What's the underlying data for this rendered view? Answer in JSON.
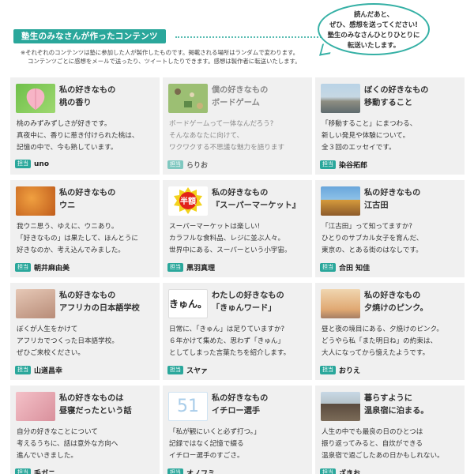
{
  "header": {
    "section_title": "塾生のみなさんが作ったコンテンツ",
    "notice_line1": "※それぞれのコンテンツは塾に参加した人が製作したものです。掲載される場所はランダムで変わります。",
    "notice_line2": "コンテンツごとに感想をメールで送ったり、ツイートしたりできます。感想は製作者に転送いたします。",
    "bubble_line1": "読んだあと、",
    "bubble_line2": "ぜひ、感想を送ってください!",
    "bubble_line3": "塾生のみなさんひとりひとりに",
    "bubble_line4": "転送いたします。"
  },
  "badge_label": "担当",
  "cards": [
    {
      "title1": "私の好きなもの",
      "title2": "桃の香り",
      "desc": [
        "桃のみずみずしさが好きです。",
        "真夜中に、香りに惹き付けられた桃は、",
        "記憶の中で、今も熟しています。"
      ],
      "author": "uno",
      "thumb": "peach-icon"
    },
    {
      "title1": "僕の好きなもの",
      "title2": "ボードゲーム",
      "desc": [
        "ボードゲームって一体なんだろう?",
        "そんなあなたに向けて、",
        "ワクワクする不思議な魅力を語ります"
      ],
      "author": "らりお",
      "thumb": "board-game-icon"
    },
    {
      "title1": "ぼくの好きなもの",
      "title2": "移動すること",
      "desc": [
        "「移動すること」にまつわる、",
        "新しい発見や体験について。",
        "全３回のエッセイです。"
      ],
      "author": "染谷拓郎",
      "thumb": "coast-photo"
    },
    {
      "title1": "私の好きなもの",
      "title2": "ウニ",
      "desc": [
        "我ウニ思う、ゆえに、ウニあり。",
        "「好きなもの」は果たして、ほんとうに",
        "好きなのか、考え込んでみました。"
      ],
      "author": "朝井麻由美",
      "thumb": "sea-urchin-photo"
    },
    {
      "title1": "私の好きなもの",
      "title2": "『スーパーマーケット』",
      "desc": [
        "スーパーマーケットは楽しい!",
        "カラフルな食料品、レジに並ぶ人々。",
        "世界中にある、スーパーという小宇宙。"
      ],
      "author": "黒羽真理",
      "thumb": "half-price-sticker",
      "sticker": "半額"
    },
    {
      "title1": "私の好きなもの",
      "title2": "江古田",
      "desc": [
        "「江古田」って知ってますか?",
        "ひとりのサブカル女子を育んだ、",
        "東京の、とある街のはなしです。"
      ],
      "author": "合田 知佳",
      "thumb": "town-photo"
    },
    {
      "title1": "私の好きなもの",
      "title2": "アフリカの日本語学校",
      "desc": [
        "ぼくが人生をかけて",
        "アフリカでつくった日本語学校。",
        "ぜひご来校ください。"
      ],
      "author": "山道昌幸",
      "thumb": "school-photo"
    },
    {
      "title1": "わたしの好きなもの",
      "title2": "「きゅんワード」",
      "desc": [
        "日常に、「きゅん」は足りていますか?",
        "６年かけて集めた、思わず「きゅん」",
        "としてしまった言葉たちを紹介します。"
      ],
      "author": "スヤァ",
      "thumb": "kyun-lettering",
      "thumb_text": "きゅん。"
    },
    {
      "title1": "私の好きなもの",
      "title2": "夕焼けのピンク。",
      "desc": [
        "昼と夜の境目にある、夕焼けのピンク。",
        "どうやら私「また明日ね」の約束は、",
        "大人になってから憶えたようです。"
      ],
      "author": "おりえ",
      "thumb": "sunset-photo"
    },
    {
      "title1": "私の好きなものは",
      "title2": "昼寝だったという話",
      "desc": [
        "自分の好きなことについて",
        "考えるうちに、話は意外な方向へ",
        "進んでいきました。"
      ],
      "author": "毛ガニ",
      "thumb": "nap-photo"
    },
    {
      "title1": "私の好きなもの",
      "title2": "イチロー選手",
      "desc": [
        "「私が観にいくと必ず打つ。」",
        "記録ではなく記憶で綴る",
        "イチロー選手のすごさ。"
      ],
      "author": "オノフミ",
      "thumb": "jersey-51",
      "thumb_text": "51"
    },
    {
      "title1": "暮らすように",
      "title2": "温泉宿に泊まる。",
      "desc": [
        "人生の中でも最良の日のひとつは",
        "振り返ってみると、自炊ができる",
        "温泉宿で過ごしたあの日かもしれない。"
      ],
      "author": "ざきお",
      "thumb": "onsen-photo"
    }
  ]
}
